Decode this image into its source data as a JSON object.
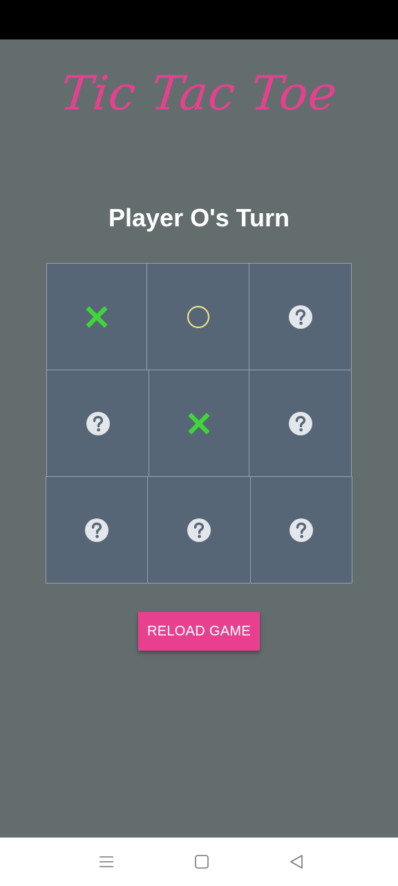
{
  "app": {
    "title": "Tic Tac Toe",
    "turn_text": "Player O's Turn",
    "reload_label": "RELOAD GAME"
  },
  "board": [
    {
      "mark": "X",
      "icon": "x-mark-icon"
    },
    {
      "mark": "O",
      "icon": "o-mark-icon"
    },
    {
      "mark": "",
      "icon": "question-icon"
    },
    {
      "mark": "",
      "icon": "question-icon"
    },
    {
      "mark": "X",
      "icon": "x-mark-icon"
    },
    {
      "mark": "",
      "icon": "question-icon"
    },
    {
      "mark": "",
      "icon": "question-icon"
    },
    {
      "mark": "",
      "icon": "question-icon"
    },
    {
      "mark": "",
      "icon": "question-icon"
    }
  ],
  "nav": {
    "items": [
      "menu-icon",
      "home-icon",
      "back-icon"
    ]
  },
  "colors": {
    "background": "#636d6e",
    "accent": "#e8408f",
    "cell": "#566676",
    "cell_border": "#93a3b2",
    "x_mark": "#3fd63a",
    "o_mark": "#ece08a",
    "question": "#e3e6ea"
  }
}
